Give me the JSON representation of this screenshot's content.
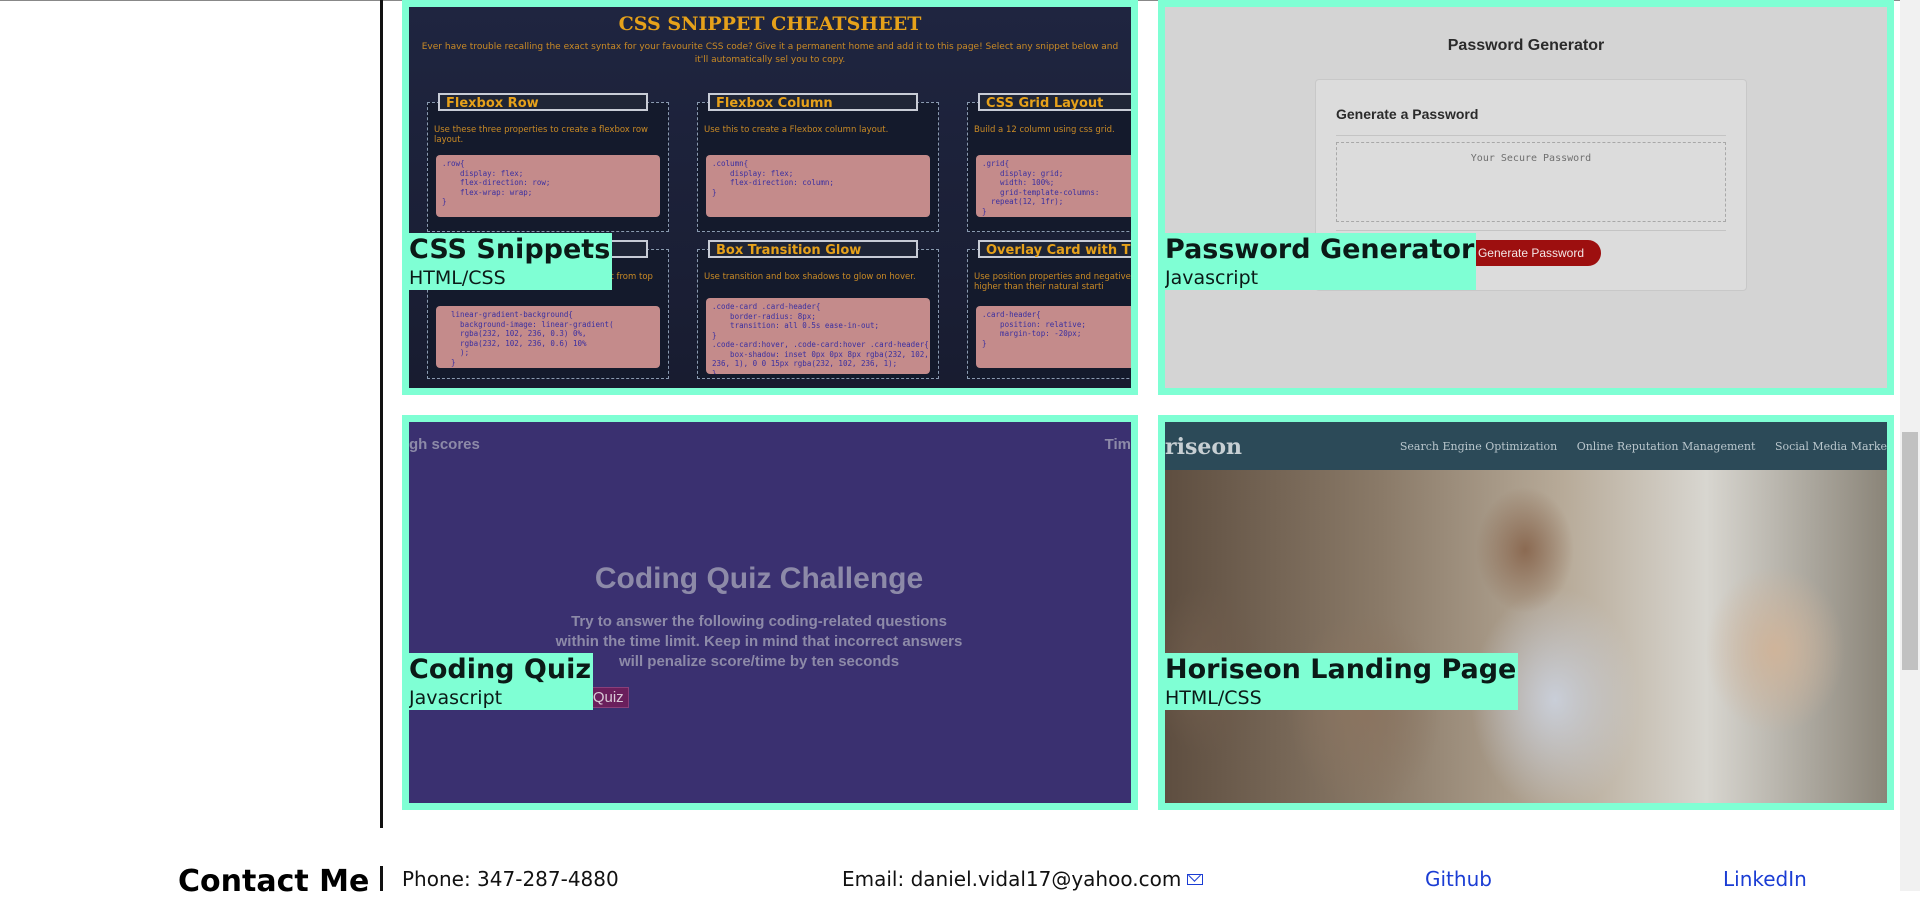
{
  "projects": [
    {
      "title": "CSS Snippets",
      "tech": "HTML/CSS",
      "preview": {
        "heading": "CSS SNIPPET CHEATSHEET",
        "intro": "Ever have trouble recalling the exact syntax for your favourite CSS code? Give it a permanent home and add it to this page! Select any snippet below and it'll automatically sel you to copy.",
        "boxes": [
          {
            "title": "Flexbox Row",
            "desc": "Use these three properties to create a flexbox row layout.",
            "code": ".row{\n    display: flex;\n    flex-direction: row;\n    flex-wrap: wrap;\n}"
          },
          {
            "title": "Flexbox Column",
            "desc": "Use this to create a Flexbox column layout.",
            "code": ".column{\n    display: flex;\n    flex-direction: column;\n}"
          },
          {
            "title": "CSS Grid Layout",
            "desc": "Build a 12 column using css grid.",
            "code": ".grid{\n    display: grid;\n    width: 100%;\n    grid-template-columns:\n  repeat(12, 1fr);\n}"
          },
          {
            "title": "",
            "desc": "gradient from top to",
            "code": "  linear-gradient-background{\n    background-image: linear-gradient(\n    rgba(232, 102, 236, 0.3) 0%,\n    rgba(232, 102, 236, 0.6) 10%\n    );\n  }"
          },
          {
            "title": "Box Transition Glow",
            "desc": "Use transition and box shadows to glow on hover.",
            "code": ".code-card .card-header{\n    border-radius: 8px;\n    transition: all 0.5s ease-in-out;\n}\n.code-card:hover, .code-card:hover .card-header{\n    box-shadow: inset 0px 0px 8px rgba(232, 102,\n236, 1), 0 0 15px rgba(232, 102, 236, 1);\n}"
          },
          {
            "title": "Overlay Card with Title",
            "desc": "Use position properties and negative m elements higher than their natural starti",
            "code": ".card-header{\n    position: relative;\n    margin-top: -20px;\n}"
          }
        ]
      }
    },
    {
      "title": "Password Generator",
      "tech": "Javascript",
      "preview": {
        "heading": "Password Generator",
        "panel_heading": "Generate a Password",
        "placeholder": "Your Secure Password",
        "button": "Generate Password"
      }
    },
    {
      "title": "Coding Quiz",
      "tech": "Javascript",
      "preview": {
        "highscores": "gh scores",
        "timer": "Tim",
        "heading": "Coding Quiz Challenge",
        "description": "Try to answer the following coding-related questions within the time limit. Keep in mind that incorrect answers will penalize score/time by ten seconds",
        "button": "tart Quiz"
      }
    },
    {
      "title": "Horiseon Landing Page",
      "tech": "HTML/CSS",
      "preview": {
        "brand": "riseon",
        "nav": [
          "Search Engine Optimization",
          "Online Reputation Management",
          "Social Media Marke"
        ]
      }
    }
  ],
  "contact": {
    "title": "Contact Me",
    "phone": "Phone: 347-287-4880",
    "email": "Email: daniel.vidal17@yahoo.com",
    "github": "Github",
    "linkedin": "LinkedIn"
  },
  "colors": {
    "accent": "#7fffd4",
    "link": "#1b3dd4"
  }
}
